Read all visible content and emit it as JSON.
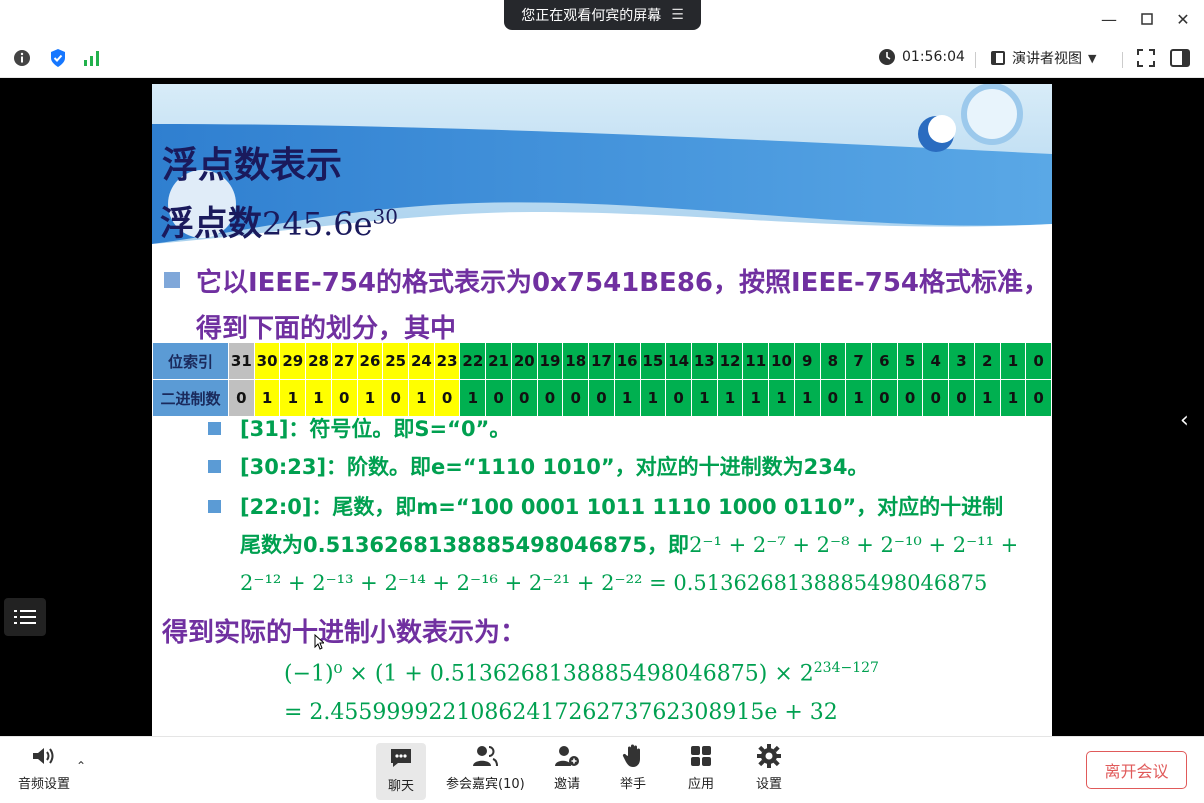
{
  "share_banner": {
    "text": "您正在观看何宾的屏幕",
    "icon": "expand-menu-icon"
  },
  "toolbar": {
    "timer": "01:56:04",
    "view_label": "演讲者视图"
  },
  "slide": {
    "title": "浮点数表示",
    "subtitle_prefix": "浮点数",
    "subtitle_math": "245.6e",
    "subtitle_exp": "30",
    "para1": "它以IEEE-754的格式表示为0x7541BE86，按照IEEE-754格式标准，得到下面的划分，其中",
    "table": {
      "row1_header": "位索引",
      "row2_header": "二进制数",
      "indices": [
        "31",
        "30",
        "29",
        "28",
        "27",
        "26",
        "25",
        "24",
        "23",
        "22",
        "21",
        "20",
        "19",
        "18",
        "17",
        "16",
        "15",
        "14",
        "13",
        "12",
        "11",
        "10",
        "9",
        "8",
        "7",
        "6",
        "5",
        "4",
        "3",
        "2",
        "1",
        "0"
      ],
      "bits": [
        "0",
        "1",
        "1",
        "1",
        "0",
        "1",
        "0",
        "1",
        "0",
        "1",
        "0",
        "0",
        "0",
        "0",
        "0",
        "1",
        "1",
        "0",
        "1",
        "1",
        "1",
        "1",
        "1",
        "0",
        "1",
        "0",
        "0",
        "0",
        "0",
        "1",
        "1",
        "0"
      ]
    },
    "b1": "[31]：符号位。即S=“0”。",
    "b2": "[30:23]：阶数。即e=“1110 1010”，对应的十进制数为234。",
    "b3_line1": "[22:0]：尾数，即m=“100 0001 1011 1110 1000 0110”，对应的十进制",
    "b3_line2_text": "尾数为0.51362681388854980468​75，即",
    "b3_line2_math": "2⁻¹ + 2⁻⁷ + 2⁻⁸ + 2⁻¹⁰ + 2⁻¹¹ +",
    "b3_line3_math": "2⁻¹² + 2⁻¹³ + 2⁻¹⁴ + 2⁻¹⁶ + 2⁻²¹ + 2⁻²² = 0.5136268138885498046875",
    "result_heading": "得到实际的十进制小数表示为：",
    "eq1": "(−1)⁰ × (1 + 0.5136268138885498046875) × 2",
    "eq1_exp": "234−127",
    "eq2": "= 2.4559999221086241726273762308915e + 32"
  },
  "bottom": {
    "audio": "音频设置",
    "chat": "聊天",
    "participants": "参会嘉宾(10)",
    "invite": "邀请",
    "raise": "举手",
    "apps": "应用",
    "settings": "设置",
    "leave": "离开会议"
  }
}
